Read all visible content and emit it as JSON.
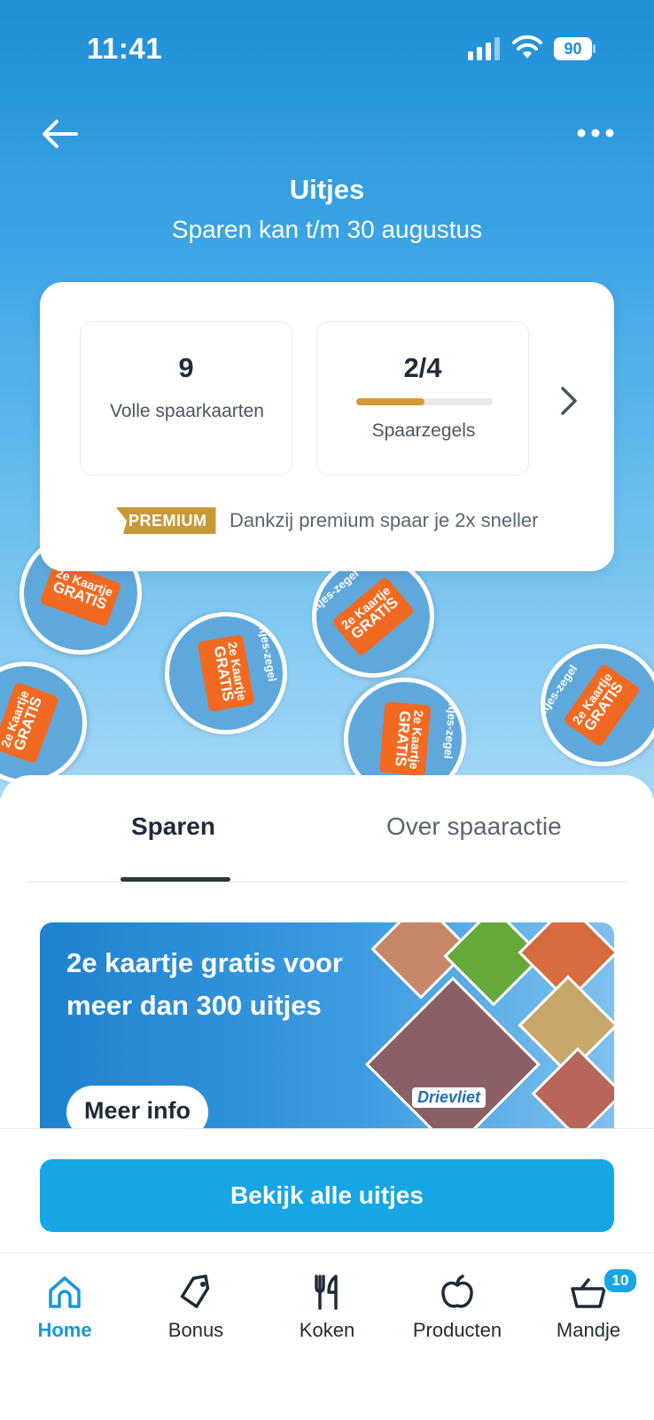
{
  "status_bar": {
    "time": "11:41",
    "battery": "90"
  },
  "header": {
    "title": "Uitjes",
    "subtitle": "Sparen kan t/m 30 augustus"
  },
  "savings_card": {
    "full_cards_value": "9",
    "full_cards_label": "Volle spaarkaarten",
    "stamps_value": "2/4",
    "stamps_progress_fraction": 0.5,
    "stamps_label": "Spaarzegels",
    "premium_badge": "PREMIUM",
    "premium_text": "Dankzij premium spaar je 2x sneller"
  },
  "stamps": {
    "ring_text": "Uitjes-zegel",
    "ticket_line1": "2e Kaartje",
    "ticket_line2": "GRATIS"
  },
  "tabs": {
    "sparen": "Sparen",
    "over": "Over spaaractie"
  },
  "banner": {
    "text": "2e kaartje gratis voor meer dan 300 uitjes",
    "button": "Meer info",
    "tile_label": "Drievliet"
  },
  "cta": {
    "label": "Bekijk alle uitjes"
  },
  "tabbar": {
    "home": "Home",
    "bonus": "Bonus",
    "koken": "Koken",
    "producten": "Producten",
    "mandje": "Mandje",
    "mandje_badge": "10"
  },
  "colors": {
    "primary": "#16a6e3",
    "premium": "#c99736",
    "stamp_orange": "#f26a21",
    "progress": "#d39a33"
  },
  "icons": [
    "back-arrow-icon",
    "more-icon",
    "chevron-right-icon",
    "home-icon",
    "bonus-tag-icon",
    "cutlery-icon",
    "apple-icon",
    "basket-icon"
  ]
}
